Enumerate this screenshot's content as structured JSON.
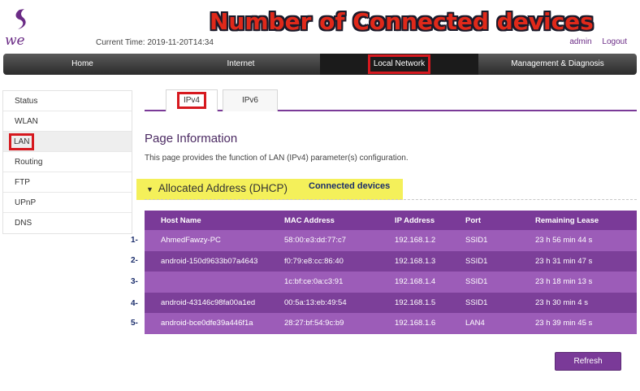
{
  "brand": {
    "logo_text": "we",
    "accent": "#7a3a98",
    "highlight": "#d6191f"
  },
  "header": {
    "time_label": "Current Time: 2019-11-20T14:34",
    "banner": "Number of Connected devices",
    "user": "admin",
    "logout": "Logout"
  },
  "nav": {
    "items": [
      {
        "label": "Home"
      },
      {
        "label": "Internet"
      },
      {
        "label": "Local Network"
      },
      {
        "label": "Management & Diagnosis"
      }
    ],
    "active": "Local Network"
  },
  "sidebar": {
    "items": [
      {
        "label": "Status"
      },
      {
        "label": "WLAN"
      },
      {
        "label": "LAN"
      },
      {
        "label": "Routing"
      },
      {
        "label": "FTP"
      },
      {
        "label": "UPnP"
      },
      {
        "label": "DNS"
      }
    ],
    "active": "LAN"
  },
  "tabs": {
    "ipv4": "IPv4",
    "ipv6": "IPv6",
    "active": "IPv4"
  },
  "page": {
    "title": "Page Information",
    "desc": "This page provides the function of LAN (IPv4) parameter(s) configuration."
  },
  "section": {
    "title": "Allocated Address (DHCP)",
    "note": "Connected devices"
  },
  "table": {
    "headers": [
      "Host Name",
      "MAC Address",
      "IP Address",
      "Port",
      "Remaining Lease"
    ],
    "rows": [
      {
        "num": "1-",
        "host": "AhmedFawzy-PC",
        "mac": "58:00:e3:dd:77:c7",
        "ip": "192.168.1.2",
        "port": "SSID1",
        "lease": "23 h 56 min 44 s"
      },
      {
        "num": "2-",
        "host": "android-150d9633b07a4643",
        "mac": "f0:79:e8:cc:86:40",
        "ip": "192.168.1.3",
        "port": "SSID1",
        "lease": "23 h 31 min 47 s"
      },
      {
        "num": "3-",
        "host": "",
        "mac": "1c:bf:ce:0a:c3:91",
        "ip": "192.168.1.4",
        "port": "SSID1",
        "lease": "23 h 18 min 13 s"
      },
      {
        "num": "4-",
        "host": "android-43146c98fa00a1ed",
        "mac": "00:5a:13:eb:49:54",
        "ip": "192.168.1.5",
        "port": "SSID1",
        "lease": "23 h 30 min 4 s"
      },
      {
        "num": "5-",
        "host": "android-bce0dfe39a446f1a",
        "mac": "28:27:bf:54:9c:b9",
        "ip": "192.168.1.6",
        "port": "LAN4",
        "lease": "23 h 39 min 45 s"
      }
    ]
  },
  "actions": {
    "refresh": "Refresh"
  }
}
